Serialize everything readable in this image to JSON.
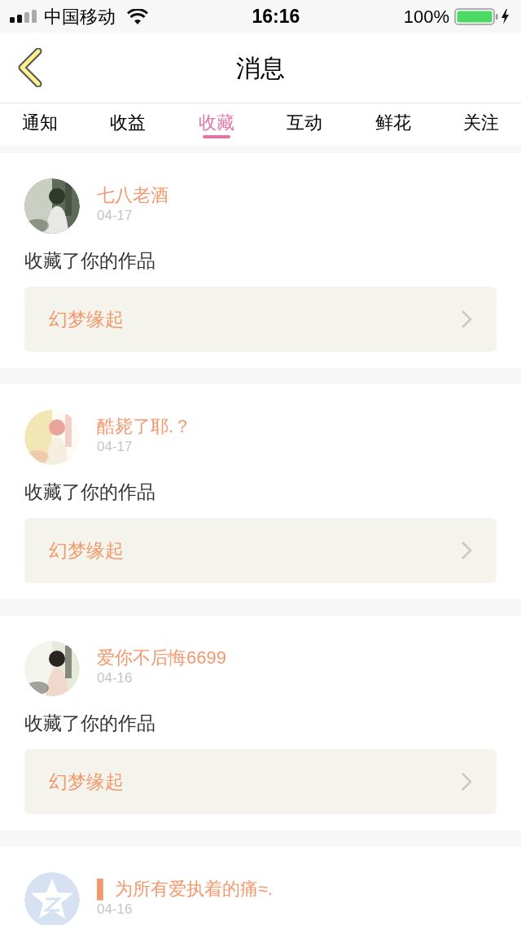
{
  "status_bar": {
    "carrier": "中国移动",
    "time": "16:16",
    "battery": "100%"
  },
  "nav": {
    "title": "消息"
  },
  "tabs": [
    {
      "label": "通知",
      "selected": false
    },
    {
      "label": "收益",
      "selected": false
    },
    {
      "label": "收藏",
      "selected": true
    },
    {
      "label": "互动",
      "selected": false
    },
    {
      "label": "鲜花",
      "selected": false
    },
    {
      "label": "关注",
      "selected": false
    }
  ],
  "messages": [
    {
      "name": "七八老酒",
      "date": "04-17",
      "text": "收藏了你的作品",
      "work": "幻梦缘起"
    },
    {
      "name": "酷毙了耶.？",
      "date": "04-17",
      "text": "收藏了你的作品",
      "work": "幻梦缘起"
    },
    {
      "name": "爱你不后悔6699",
      "date": "04-16",
      "text": "收藏了你的作品",
      "work": "幻梦缘起"
    },
    {
      "avatar": {
        "kind": "default"
      },
      "name": "▌ 为所有爱执着的痛≈.",
      "date": "04-16"
    }
  ]
}
